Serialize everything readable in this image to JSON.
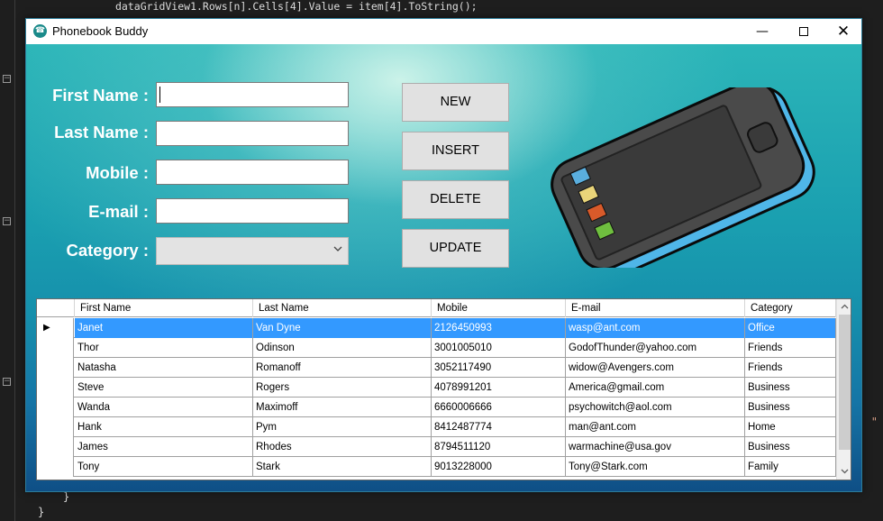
{
  "editor": {
    "code_top": "dataGridView1.Rows[n].Cells[4].Value = item[4].ToString();",
    "brace_inner": "}",
    "brace_outer": "}",
    "code_fragment": "\""
  },
  "window": {
    "title": "Phonebook Buddy",
    "minimize_label": "—",
    "close_label": "✕"
  },
  "form": {
    "first_name_label": "First Name :",
    "last_name_label": "Last Name :",
    "mobile_label": "Mobile :",
    "email_label": "E-mail :",
    "category_label": "Category :",
    "first_name_value": "",
    "last_name_value": "",
    "mobile_value": "",
    "email_value": "",
    "category_value": ""
  },
  "buttons": {
    "new": "NEW",
    "insert": "INSERT",
    "delete": "DELETE",
    "update": "UPDATE"
  },
  "grid": {
    "columns": [
      "First Name",
      "Last Name",
      "Mobile",
      "E-mail",
      "Category"
    ],
    "rows": [
      [
        "Janet",
        "Van Dyne",
        "2126450993",
        "wasp@ant.com",
        "Office"
      ],
      [
        "Thor",
        "Odinson",
        "3001005010",
        "GodofThunder@yahoo.com",
        "Friends"
      ],
      [
        "Natasha",
        "Romanoff",
        "3052117490",
        "widow@Avengers.com",
        "Friends"
      ],
      [
        "Steve",
        "Rogers",
        "4078991201",
        "America@gmail.com",
        "Business"
      ],
      [
        "Wanda",
        "Maximoff",
        "6660006666",
        "psychowitch@aol.com",
        "Business"
      ],
      [
        "Hank",
        "Pym",
        "8412487774",
        "man@ant.com",
        "Home"
      ],
      [
        "James",
        "Rhodes",
        "8794511120",
        "warmachine@usa.gov",
        "Business"
      ],
      [
        "Tony",
        "Stark",
        "9013228000",
        "Tony@Stark.com",
        "Family"
      ]
    ],
    "selected_row": 0
  },
  "colors": {
    "selection": "#3399ff",
    "background_top": "#2bb5b8",
    "background_bottom": "#0f4f86"
  }
}
